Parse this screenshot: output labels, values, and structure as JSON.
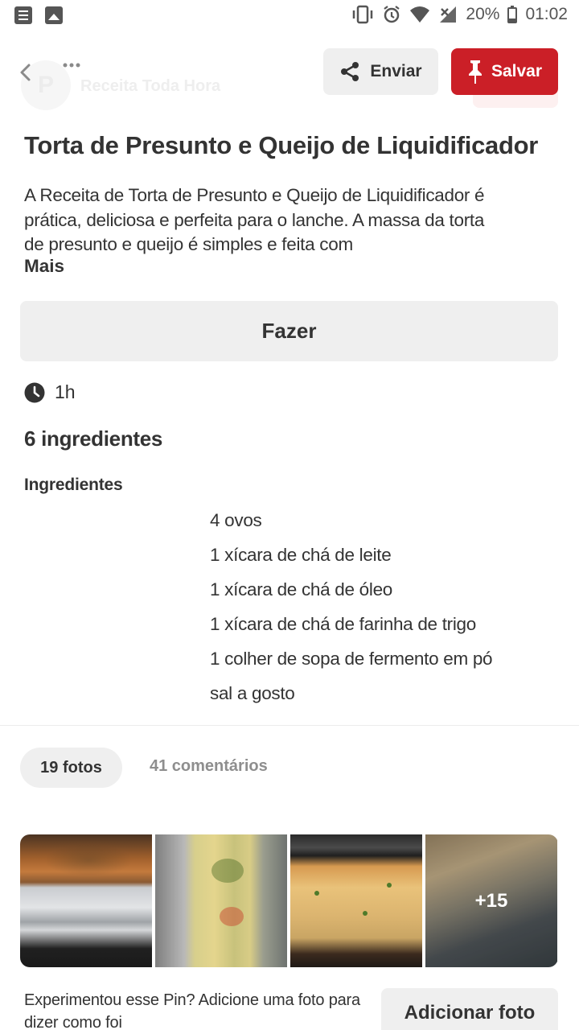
{
  "status_bar": {
    "battery": "20%",
    "time": "01:02",
    "left_icons": [
      "notes-icon",
      "image-icon"
    ],
    "right_icons": [
      "vibrate-icon",
      "alarm-icon",
      "wifi-icon",
      "signal-icon",
      "battery-icon"
    ]
  },
  "header": {
    "back_icon": "chevron-left-icon",
    "more_icon": "more-dots-icon",
    "profile_initial": "P",
    "profile_name": "Receita Toda Hora",
    "send_label": "Enviar",
    "save_label": "Salvar",
    "accent_color": "#cb1f27"
  },
  "pin": {
    "title": "Torta de Presunto e Queijo de Liquidificador",
    "description": "A Receita de Torta de Presunto e Queijo de Liquidificador é prática, deliciosa e perfeita para o lanche. A massa da torta de presunto e queijo é simples e feita com",
    "more_label": "Mais",
    "make_label": "Fazer",
    "time": "1h",
    "ingredient_count": "6 ingredientes",
    "ingredients_heading": "Ingredientes",
    "ingredients": [
      "4 ovos",
      "1 xícara de chá de leite",
      "1 xícara de chá de óleo",
      "1 xícara de chá de farinha de trigo",
      "1 colher de sopa de fermento em pó",
      "sal a gosto"
    ]
  },
  "tabs": {
    "photos": "19 fotos",
    "comments": "41 comentários",
    "active": "photos"
  },
  "photos": {
    "more_count": "+15"
  },
  "try_it": {
    "text": "Experimentou esse Pin? Adicione uma foto para dizer como foi",
    "button": "Adicionar foto"
  }
}
